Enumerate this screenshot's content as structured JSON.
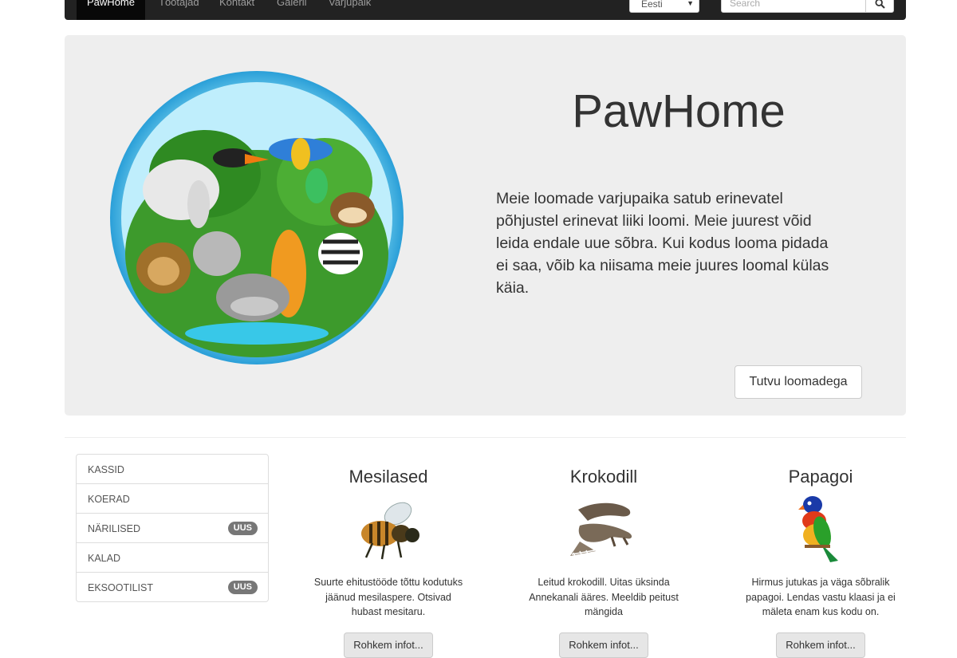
{
  "nav": {
    "brand": "PawHome",
    "links": [
      "Töötajad",
      "Kontakt",
      "Galerii",
      "Varjupaik"
    ],
    "language": "Eesti",
    "search_placeholder": "Search"
  },
  "hero": {
    "title": "PawHome",
    "text": "Meie loomade varjupaika satub erinevatel põhjustel erinevat liiki loomi. Meie juurest võid leida endale uue sõbra. Kui kodus looma pidada ei saa, võib ka niisama meie juures loomal külas käia.",
    "button": "Tutvu loomadega"
  },
  "sidebar": {
    "items": [
      {
        "label": "KASSID",
        "badge": ""
      },
      {
        "label": "KOERAD",
        "badge": ""
      },
      {
        "label": "NÄRILISED",
        "badge": "UUS"
      },
      {
        "label": "KALAD",
        "badge": ""
      },
      {
        "label": "EKSOOTILIST",
        "badge": "UUS"
      }
    ]
  },
  "cards": [
    {
      "title": "Mesilased",
      "text": "Suurte ehitustööde tõttu kodutuks jäänud mesilaspere. Otsivad hubast mesitaru.",
      "button": "Rohkem infot..."
    },
    {
      "title": "Krokodill",
      "text": "Leitud krokodill. Uitas üksinda Annekanali ääres. Meeldib peitust mängida",
      "button": "Rohkem infot..."
    },
    {
      "title": "Papagoi",
      "text": "Hirmus jutukas ja väga sõbralik papagoi. Lendas vastu klaasi ja ei mäleta enam kus kodu on.",
      "button": "Rohkem infot..."
    }
  ]
}
